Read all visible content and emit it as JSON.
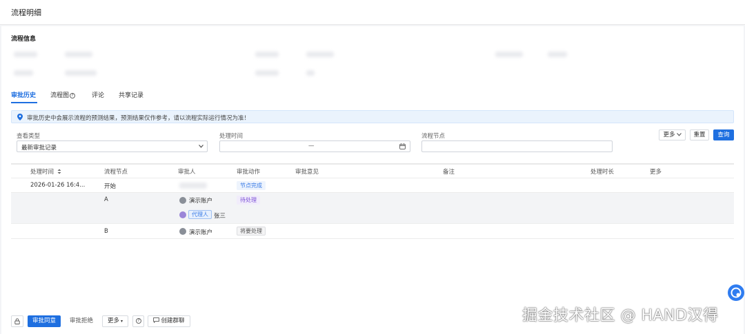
{
  "header": {
    "title": "流程明细"
  },
  "section": {
    "title": "流程信息"
  },
  "tabs": [
    {
      "label": "审批历史",
      "active": true
    },
    {
      "label": "流程图",
      "icon": "help-circle-icon"
    },
    {
      "label": "评论"
    },
    {
      "label": "共享记录"
    }
  ],
  "notice": {
    "text": "审批历史中会展示流程的预测结果，预测结果仅作参考，请以流程实际运行情况为准！"
  },
  "filters": {
    "view_type_label": "查看类型",
    "view_type_value": "最新审批记录",
    "process_time_label": "处理时间",
    "date_separator": "—",
    "node_label": "流程节点",
    "more_label": "更多",
    "reset_label": "重置",
    "query_label": "查询"
  },
  "table": {
    "headers": [
      "处理时间",
      "流程节点",
      "审批人",
      "审批动作",
      "审批意见",
      "备注",
      "处理时长",
      "更多"
    ],
    "rows": [
      {
        "time": "2026-01-26 16:4...",
        "node": "开始",
        "approver": "",
        "action": "节点完成"
      },
      {
        "time": "",
        "node": "A",
        "approver": "演示账户",
        "action": "待处理",
        "proxy_tag": "代理人",
        "proxy_name": "张三"
      },
      {
        "time": "",
        "node": "B",
        "approver": "演示账户",
        "action": "将要处理"
      }
    ]
  },
  "bottom": {
    "approve_label": "审批同意",
    "reject_label": "审批拒绝",
    "more_label": "更多",
    "group_chat_label": "创建群聊"
  },
  "watermark": "掘金技术社区 @ HAND汉得",
  "colors": {
    "primary": "#1e6fe0",
    "notice_bg": "#eaf3fd",
    "tag_blue": "#3a7be6",
    "tag_purple": "#7a4fd6"
  }
}
